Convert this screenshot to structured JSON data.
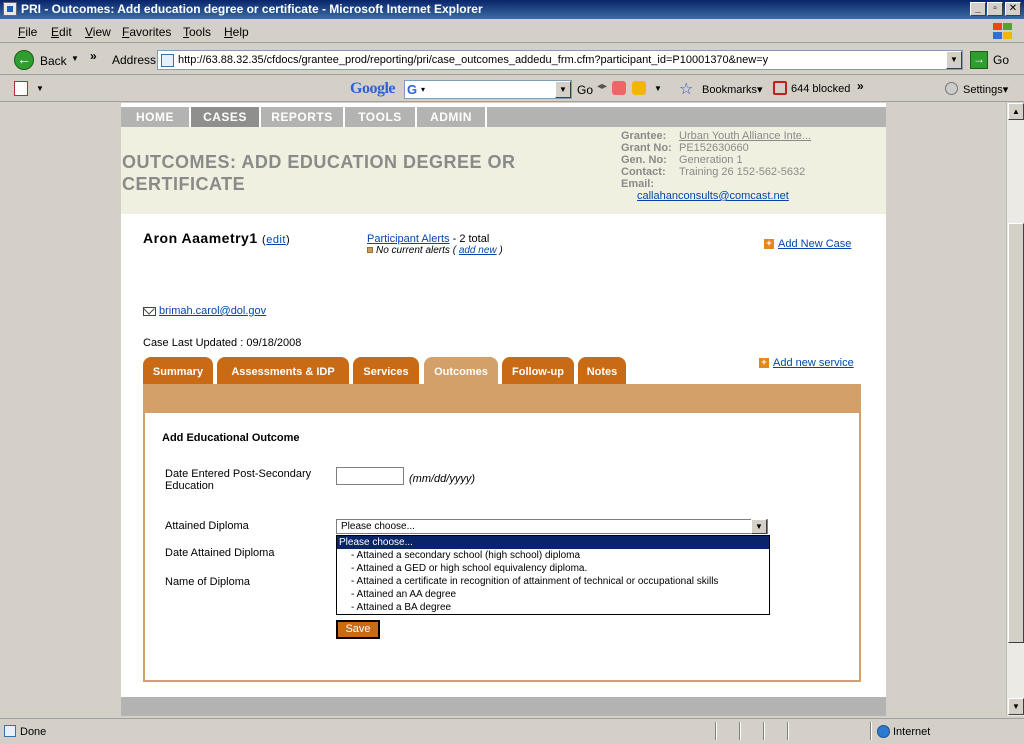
{
  "window": {
    "title": "PRI - Outcomes: Add education degree or certificate - Microsoft Internet Explorer"
  },
  "menu": {
    "items": [
      {
        "label": "File",
        "hotkey": "F",
        "rest": "ile"
      },
      {
        "label": "Edit",
        "hotkey": "E",
        "rest": "dit"
      },
      {
        "label": "View",
        "hotkey": "V",
        "rest": "iew"
      },
      {
        "label": "Favorites",
        "hotkey": "F",
        "rest": "avorites"
      },
      {
        "label": "Tools",
        "hotkey": "T",
        "rest": "ools"
      },
      {
        "label": "Help",
        "hotkey": "H",
        "rest": "elp"
      }
    ]
  },
  "addressbar": {
    "back_label": "Back",
    "address_label": "Address",
    "url": "http://63.88.32.35/cfdocs/grantee_prod/reporting/pri/case_outcomes_addedu_frm.cfm?participant_id=P10001370&new=y",
    "go_label": "Go"
  },
  "google_toolbar": {
    "logo": "Google",
    "go_label": "Go",
    "bookmarks_label": "Bookmarks",
    "blocked_label": "644 blocked",
    "settings_label": "Settings"
  },
  "site_nav": {
    "items": [
      "HOME",
      "CASES",
      "REPORTS",
      "TOOLS",
      "ADMIN"
    ],
    "active": "CASES"
  },
  "header": {
    "title": "OUTCOMES: ADD EDUCATION DEGREE OR CERTIFICATE",
    "grantee": {
      "grantee_label": "Grantee:",
      "grantee_value": "Urban Youth Alliance Inte...",
      "grant_no_label": "Grant No:",
      "grant_no_value": "PE152630660",
      "gen_no_label": "Gen. No:",
      "gen_no_value": "Generation 1",
      "contact_label": "Contact:",
      "contact_value": "Training 26  152-562-5632",
      "email_label": "Email:",
      "email_value": "callahanconsults@comcast.net"
    }
  },
  "participant": {
    "name": "Aron Aaametry1",
    "edit_label": "edit",
    "alerts_link": "Participant Alerts",
    "alerts_total": "- 2 total",
    "no_alerts": "No current alerts",
    "add_new": "add new",
    "add_new_case": "Add New Case",
    "email": "brimah.carol@dol.gov",
    "last_updated": "Case Last Updated : 09/18/2008"
  },
  "tabs": [
    {
      "label": "Summary"
    },
    {
      "label": "Assessments & IDP"
    },
    {
      "label": "Services"
    },
    {
      "label": "Outcomes"
    },
    {
      "label": "Follow-up"
    },
    {
      "label": "Notes"
    }
  ],
  "active_tab": "Outcomes",
  "add_new_service": "Add new service",
  "form": {
    "title": "Add Educational Outcome",
    "date_entered_label": "Date Entered Post-Secondary Education",
    "date_format_hint": "(mm/dd/yyyy)",
    "attained_diploma_label": "Attained Diploma",
    "attained_diploma_value": "Please choose...",
    "date_attained_label": "Date Attained Diploma",
    "name_of_diploma_label": "Name of Diploma",
    "options": [
      "Please choose...",
      "- Attained a secondary school (high school) diploma",
      "- Attained a GED or high school equivalency diploma.",
      "- Attained a certificate in recognition of attainment of technical or occupational skills",
      "- Attained an AA degree",
      "- Attained a BA degree"
    ],
    "save_label": "Save"
  },
  "status": {
    "left": "Done",
    "zone": "Internet"
  },
  "colors": {
    "tab_orange": "#c96a14",
    "tab_active": "#d4a06a",
    "header_bg": "#f0f0e0",
    "nav_gray": "#b3b3b3"
  }
}
